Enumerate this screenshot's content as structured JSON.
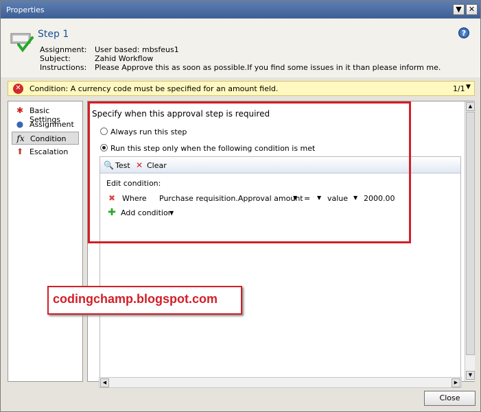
{
  "window": {
    "title": "Properties",
    "dropdown_icon": "▼",
    "close_icon": "✕"
  },
  "header": {
    "step_title": "Step 1",
    "fields": [
      {
        "label": "Assignment:",
        "value": "User based: mbsfeus1"
      },
      {
        "label": "Subject:",
        "value": "Zahid Workflow"
      },
      {
        "label": "Instructions:",
        "value": "Please Approve this as soon as possible.If you find some issues in it than please inform me."
      }
    ],
    "help_icon": "?"
  },
  "warning": {
    "text": "Condition: A currency code must be specified for an amount field.",
    "count": "1/1",
    "icon": "✕"
  },
  "nav": {
    "items": [
      {
        "label": "Basic Settings",
        "icon": "asterisk-icon",
        "glyph": "✱"
      },
      {
        "label": "Assignment",
        "icon": "user-icon",
        "glyph": "👤"
      },
      {
        "label": "Condition",
        "icon": "function-icon",
        "glyph": "fx"
      },
      {
        "label": "Escalation",
        "icon": "escalation-icon",
        "glyph": "⬆"
      }
    ],
    "selected": "Condition"
  },
  "content": {
    "heading": "Specify when this approval step is required",
    "options": [
      {
        "label": "Always run this step",
        "checked": false
      },
      {
        "label": "Run this step only when the following condition is met",
        "checked": true
      }
    ],
    "toolbar": {
      "test_label": "Test",
      "clear_label": "Clear"
    },
    "edit_condition_label": "Edit condition:",
    "condition_row": {
      "where": "Where",
      "field": "Purchase requisition.Approval amount",
      "operator": "=",
      "value_type": "value",
      "value": "2000.00"
    },
    "add_condition_label": "Add condition"
  },
  "watermark": "codingchamp.blogspot.com",
  "footer": {
    "close_label": "Close"
  },
  "colors": {
    "accent": "#1b4e9a",
    "annotation_red": "#d11f27",
    "warning_bg": "#fff8c0"
  }
}
